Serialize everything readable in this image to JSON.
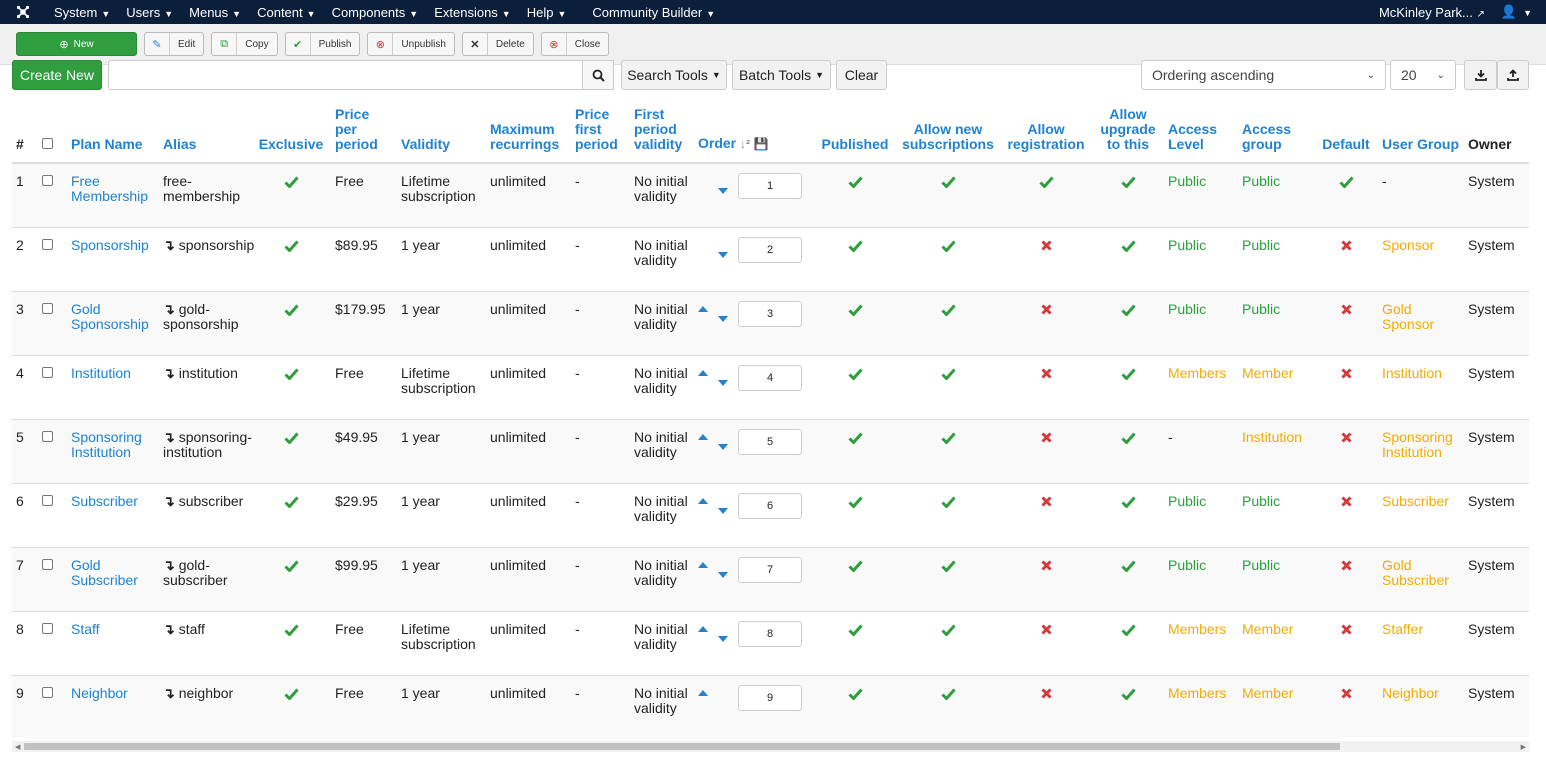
{
  "nav": {
    "menus": [
      "System",
      "Users",
      "Menus",
      "Content",
      "Components",
      "Extensions",
      "Help",
      "Community Builder"
    ],
    "site_name": "McKinley Park...",
    "user": ""
  },
  "toolbar": {
    "new": "New",
    "edit": "Edit",
    "copy": "Copy",
    "publish": "Publish",
    "unpublish": "Unpublish",
    "delete": "Delete",
    "close": "Close"
  },
  "filter": {
    "create_new": "Create New",
    "search_placeholder": "",
    "search_tools": "Search Tools",
    "batch_tools": "Batch Tools",
    "clear": "Clear",
    "ordering": "Ordering ascending",
    "limit": "20"
  },
  "table": {
    "headers": {
      "num": "#",
      "plan_name": "Plan Name",
      "alias": "Alias",
      "exclusive": "Exclusive",
      "price": "Price per period",
      "validity": "Validity",
      "max_rec": "Maximum recurrings",
      "price_first": "Price first period",
      "first_validity": "First period validity",
      "order": "Order",
      "published": "Published",
      "allow_new": "Allow new subscriptions",
      "allow_reg": "Allow registration",
      "allow_upgrade": "Allow upgrade to this",
      "access_level": "Access Level",
      "access_group": "Access group",
      "default": "Default",
      "user_group": "User Group",
      "owner": "Owner"
    },
    "rows": [
      {
        "num": "1",
        "name": "Free Membership",
        "alias": "free-membership",
        "alias_nested": false,
        "exclusive": true,
        "price": "Free",
        "validity": "Lifetime subscription",
        "max_rec": "unlimited",
        "price_first": "-",
        "first_validity": "No initial validity",
        "up": false,
        "down": true,
        "order": "1",
        "published": true,
        "allow_new": true,
        "allow_reg": true,
        "allow_upgrade": true,
        "access_level": "Public",
        "access_level_color": "green",
        "access_group": "Public",
        "access_group_color": "green",
        "default": true,
        "user_group": "-",
        "user_group_color": "plain",
        "owner": "System"
      },
      {
        "num": "2",
        "name": "Sponsorship",
        "alias": "sponsorship",
        "alias_nested": true,
        "exclusive": true,
        "price": "$89.95",
        "validity": "1 year",
        "max_rec": "unlimited",
        "price_first": "-",
        "first_validity": "No initial validity",
        "up": false,
        "down": true,
        "order": "2",
        "published": true,
        "allow_new": true,
        "allow_reg": false,
        "allow_upgrade": true,
        "access_level": "Public",
        "access_level_color": "green",
        "access_group": "Public",
        "access_group_color": "green",
        "default": false,
        "user_group": "Sponsor",
        "user_group_color": "yellow",
        "owner": "System"
      },
      {
        "num": "3",
        "name": "Gold Sponsorship",
        "alias": "gold-sponsorship",
        "alias_nested": true,
        "exclusive": true,
        "price": "$179.95",
        "validity": "1 year",
        "max_rec": "unlimited",
        "price_first": "-",
        "first_validity": "No initial validity",
        "up": true,
        "down": true,
        "order": "3",
        "published": true,
        "allow_new": true,
        "allow_reg": false,
        "allow_upgrade": true,
        "access_level": "Public",
        "access_level_color": "green",
        "access_group": "Public",
        "access_group_color": "green",
        "default": false,
        "user_group": "Gold Sponsor",
        "user_group_color": "yellow",
        "owner": "System"
      },
      {
        "num": "4",
        "name": "Institution",
        "alias": "institution",
        "alias_nested": true,
        "exclusive": true,
        "price": "Free",
        "validity": "Lifetime subscription",
        "max_rec": "unlimited",
        "price_first": "-",
        "first_validity": "No initial validity",
        "up": true,
        "down": true,
        "order": "4",
        "published": true,
        "allow_new": true,
        "allow_reg": false,
        "allow_upgrade": true,
        "access_level": "Members",
        "access_level_color": "yellow",
        "access_group": "Member",
        "access_group_color": "yellow",
        "default": false,
        "user_group": "Institution",
        "user_group_color": "yellow",
        "owner": "System"
      },
      {
        "num": "5",
        "name": "Sponsoring Institution",
        "alias": "sponsoring-institution",
        "alias_nested": true,
        "exclusive": true,
        "price": "$49.95",
        "validity": "1 year",
        "max_rec": "unlimited",
        "price_first": "-",
        "first_validity": "No initial validity",
        "up": true,
        "down": true,
        "order": "5",
        "published": true,
        "allow_new": true,
        "allow_reg": false,
        "allow_upgrade": true,
        "access_level": "-",
        "access_level_color": "plain",
        "access_group": "Institution",
        "access_group_color": "yellow",
        "default": false,
        "user_group": "Sponsoring Institution",
        "user_group_color": "yellow",
        "owner": "System"
      },
      {
        "num": "6",
        "name": "Subscriber",
        "alias": "subscriber",
        "alias_nested": true,
        "exclusive": true,
        "price": "$29.95",
        "validity": "1 year",
        "max_rec": "unlimited",
        "price_first": "-",
        "first_validity": "No initial validity",
        "up": true,
        "down": true,
        "order": "6",
        "published": true,
        "allow_new": true,
        "allow_reg": false,
        "allow_upgrade": true,
        "access_level": "Public",
        "access_level_color": "green",
        "access_group": "Public",
        "access_group_color": "green",
        "default": false,
        "user_group": "Subscriber",
        "user_group_color": "yellow",
        "owner": "System"
      },
      {
        "num": "7",
        "name": "Gold Subscriber",
        "alias": "gold-subscriber",
        "alias_nested": true,
        "exclusive": true,
        "price": "$99.95",
        "validity": "1 year",
        "max_rec": "unlimited",
        "price_first": "-",
        "first_validity": "No initial validity",
        "up": true,
        "down": true,
        "order": "7",
        "published": true,
        "allow_new": true,
        "allow_reg": false,
        "allow_upgrade": true,
        "access_level": "Public",
        "access_level_color": "green",
        "access_group": "Public",
        "access_group_color": "green",
        "default": false,
        "user_group": "Gold Subscriber",
        "user_group_color": "yellow",
        "owner": "System"
      },
      {
        "num": "8",
        "name": "Staff",
        "alias": "staff",
        "alias_nested": true,
        "exclusive": true,
        "price": "Free",
        "validity": "Lifetime subscription",
        "max_rec": "unlimited",
        "price_first": "-",
        "first_validity": "No initial validity",
        "up": true,
        "down": true,
        "order": "8",
        "published": true,
        "allow_new": true,
        "allow_reg": false,
        "allow_upgrade": true,
        "access_level": "Members",
        "access_level_color": "yellow",
        "access_group": "Member",
        "access_group_color": "yellow",
        "default": false,
        "user_group": "Staffer",
        "user_group_color": "yellow",
        "owner": "System"
      },
      {
        "num": "9",
        "name": "Neighbor",
        "alias": "neighbor",
        "alias_nested": true,
        "exclusive": true,
        "price": "Free",
        "validity": "1 year",
        "max_rec": "unlimited",
        "price_first": "-",
        "first_validity": "No initial validity",
        "up": true,
        "down": false,
        "order": "9",
        "published": true,
        "allow_new": true,
        "allow_reg": false,
        "allow_upgrade": true,
        "access_level": "Members",
        "access_level_color": "yellow",
        "access_group": "Member",
        "access_group_color": "yellow",
        "default": false,
        "user_group": "Neighbor",
        "user_group_color": "yellow",
        "owner": "System"
      }
    ]
  },
  "colors": {
    "navbar": "#0b1e3a",
    "green": "#2e9e3e",
    "red": "#d9363e",
    "link": "#1f83d1",
    "yellow": "#f0ad00"
  },
  "icons": {
    "check": "check-icon",
    "cross": "cross-icon",
    "order_up": "arrow-up-icon",
    "order_down": "arrow-down-icon"
  }
}
